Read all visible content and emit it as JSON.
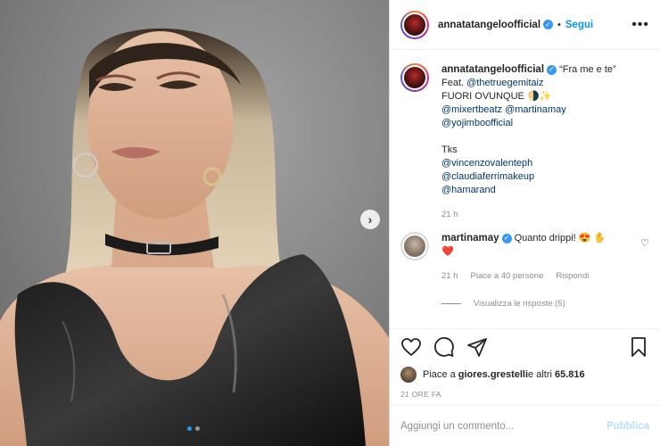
{
  "post": {
    "image_alt": "portrait",
    "carousel_dots": 2,
    "carousel_active": 0
  },
  "header": {
    "username": "annatatangeloofficial",
    "verified_icon": "verified-badge-icon",
    "bullet": "•",
    "follow_label": "Segui",
    "more_label": "•••"
  },
  "caption": {
    "username": "annatatangeloofficial",
    "text_line1": "“Fra me e te”",
    "feat_prefix": "Feat. ",
    "feat_mention": "@thetruegemitaiz",
    "line_fuori": "FUORI OVUNQUE 🌗✨",
    "mention_1": "@mixertbeatz",
    "mention_2": "@martinamay",
    "mention_3": "@yojimboofficial",
    "tks": "Tks",
    "mention_4": "@vincenzovalenteph",
    "mention_5": "@claudiaferrimakeup",
    "mention_6": "@hamarand",
    "age": "21 h"
  },
  "comment": {
    "username": "martinamay",
    "text": "Quanto drippi! 😍",
    "text_line2": "✋❤️",
    "age": "21 h",
    "likes": "Piace a 40 persone",
    "reply": "Rispondi",
    "view_replies": "Visualizza le risposte (5)"
  },
  "actions": {
    "likes_prefix": "Piace a ",
    "likes_user": "giores.grestelli",
    "likes_suffix": " e altri ",
    "likes_count": "65.816",
    "time": "21 ORE FA"
  },
  "add_comment": {
    "placeholder": "Aggiungi un commento...",
    "publish_label": "Pubblica"
  },
  "colors": {
    "link": "#00376b",
    "follow": "#0095f6",
    "muted": "#8e8e8e",
    "verified": "#3897f0",
    "publish_disabled": "#b2dffc"
  }
}
